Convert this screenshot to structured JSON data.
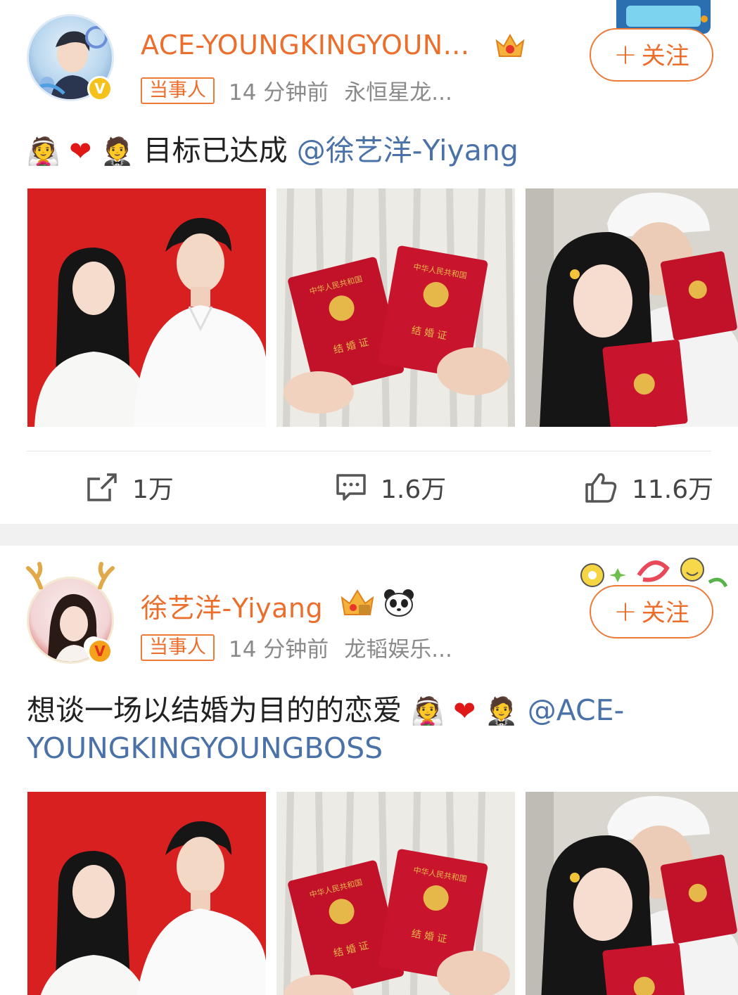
{
  "posts": [
    {
      "username": "ACE-YOUNGKINGYOUN...",
      "tag": "当事人",
      "time": "14 分钟前",
      "source": "永恒星龙...",
      "follow_label": "关注",
      "content_text": "目标已达成",
      "mention": "@徐艺洋-Yiyang",
      "actions": {
        "share": "1万",
        "comment": "1.6万",
        "like": "11.6万"
      }
    },
    {
      "username": "徐艺洋-Yiyang",
      "tag": "当事人",
      "time": "14 分钟前",
      "source": "龙韬娱乐...",
      "follow_label": "关注",
      "content_text": "想谈一场以结婚为目的的恋爱",
      "mention_part1": "@ACE-",
      "mention_part2": "YOUNGKINGYOUNGBOSS"
    }
  ],
  "certificate_text": "结 婚 证",
  "certificate_header": "中华人民共和国",
  "colors": {
    "accent": "#ec6e2c",
    "link": "#4a72a8",
    "heart": "#e01818",
    "cert_red": "#c2122a"
  }
}
